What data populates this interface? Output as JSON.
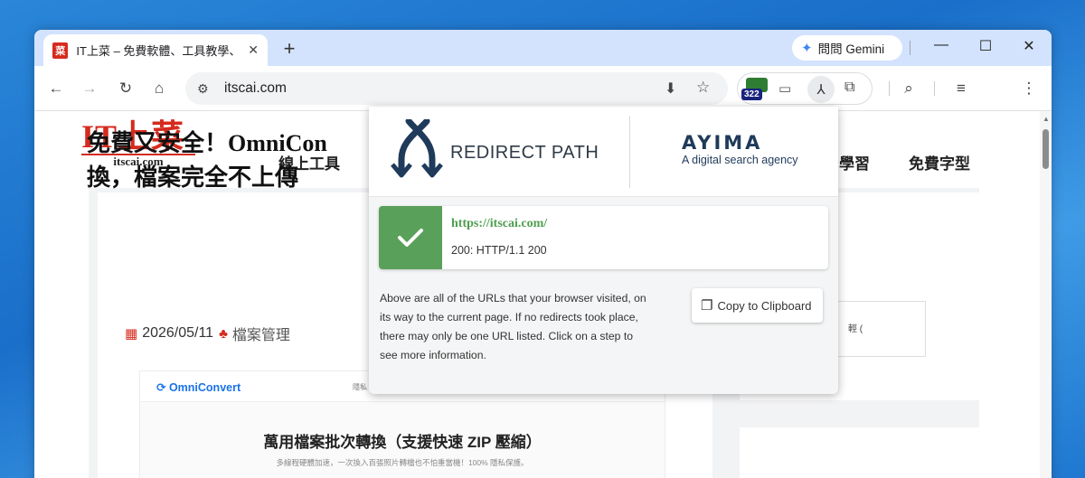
{
  "tab": {
    "title": "IT上菜 – 免費軟體、工具教學、",
    "favicon_text": "菜"
  },
  "gemini": {
    "label": "問問 Gemini"
  },
  "window_controls": {
    "minimize": "—",
    "maximize": "☐",
    "close": "✕"
  },
  "omnibox": {
    "url": "itscai.com"
  },
  "extensions": {
    "badge_count": "322"
  },
  "site": {
    "logo_main": "IT上菜",
    "logo_sub": "itscai.com",
    "nav": [
      "線上工具",
      "學習",
      "免費字型"
    ],
    "article_title": "免費又安全！OmniConvert 萬用檔案批次轉換，檔案完全不上傳",
    "article_title_visible_line1": "免費又安全！OmniCon",
    "article_title_visible_line2": "換，檔案完全不上傳",
    "date": "2026/05/11",
    "category": "檔案管理",
    "preview_logo": "OmniConvert",
    "preview_heading": "萬用檔案批次轉換（支援快速 ZIP 壓縮）",
    "preview_sub": "多線程硬體加速，一次換入百張照片轉檔也不怕重當機！100% 隱私保護。",
    "side_box_text": "輕 ("
  },
  "popup": {
    "title": "REDIRECT PATH",
    "brand": "AYIMA",
    "brand_tagline": "A digital search agency",
    "result_url": "https://itscai.com/",
    "result_code": "200: HTTP/1.1 200",
    "description": "Above are all of the URLs that your browser visited, on its way to the current page. If no redirects took place, there may only be one URL listed. Click on a step to see more information.",
    "copy_label": "Copy to Clipboard"
  },
  "colors": {
    "accent_red": "#d52b1e",
    "status_green": "#59a05a",
    "tab_strip": "#d3e3fd",
    "ayima_navy": "#1f3a5a"
  }
}
